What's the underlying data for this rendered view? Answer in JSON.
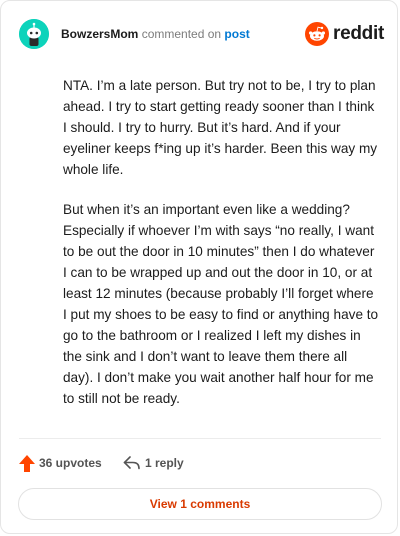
{
  "header": {
    "username": "BowzersMom",
    "action": "commented on",
    "target": "post",
    "brand": "reddit"
  },
  "comment": {
    "paragraphs": [
      "NTA. I’m a late person. But try not to be, I try to plan ahead. I try to start getting ready sooner than I think I should. I try to hurry. But it’s hard. And if your eyeliner keeps f*ing up it’s harder. Been this way my whole life.",
      "But when it’s an important even like a wedding? Especially if whoever I’m with says “no really, I want to be out the door in 10 minutes” then I do whatever I can to be wrapped up and out the door in 10, or at least 12 minutes (because probably I’ll forget where I put my shoes to be easy to find or anything have to go to the bathroom or I realized I left my dishes in the sink and I don’t want to leave them there all day). I don’t make you wait another half hour for me to still not be ready."
    ]
  },
  "actions": {
    "upvotes": "36 upvotes",
    "replies": "1 reply",
    "view_comments": "View 1 comments"
  },
  "icons": {
    "avatar": "snoo-avatar-icon",
    "brand": "reddit-logo-icon",
    "upvote": "upvote-arrow-icon",
    "reply": "reply-arrow-icon"
  },
  "colors": {
    "avatar_bg": "#0dd3bb",
    "brand_orange": "#ff4500",
    "link_blue": "#0079d3",
    "view_text": "#d93a00"
  }
}
